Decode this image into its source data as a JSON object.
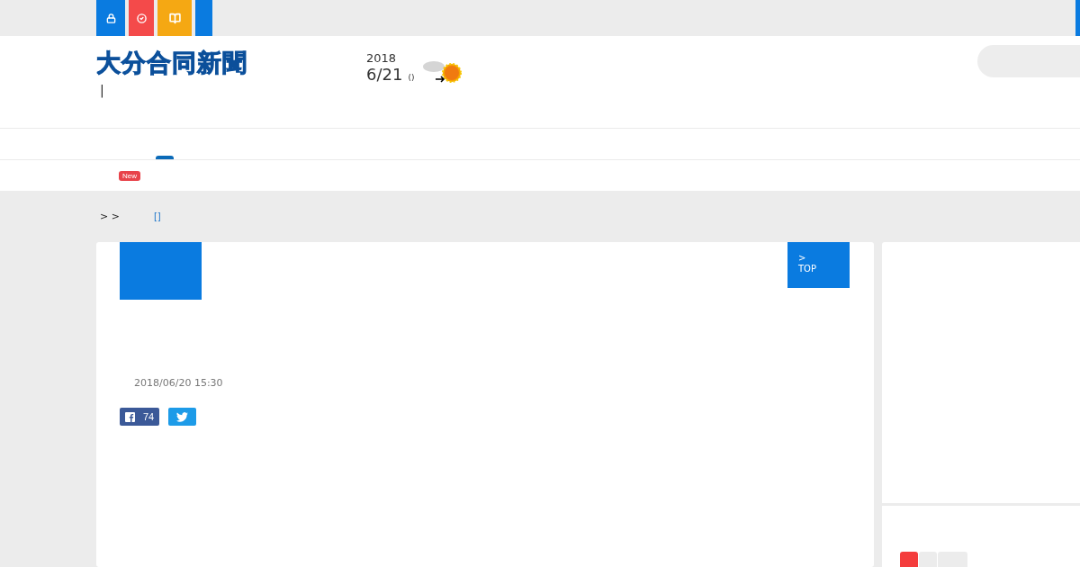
{
  "header": {
    "logo": "大分合同新聞",
    "separator": "|",
    "year": "2018",
    "date": "6/21",
    "weekday": "()"
  },
  "new_badge": "New",
  "breadcrumb": {
    "trail": "> >",
    "tag": "[]"
  },
  "article": {
    "back_link": [
      ">",
      "TOP"
    ],
    "timestamp": "2018/06/20 15:30",
    "facebook_count": "74"
  },
  "sidebar_tabs": [
    {
      "selected": true
    },
    {
      "selected": false
    },
    {
      "selected": false
    }
  ]
}
